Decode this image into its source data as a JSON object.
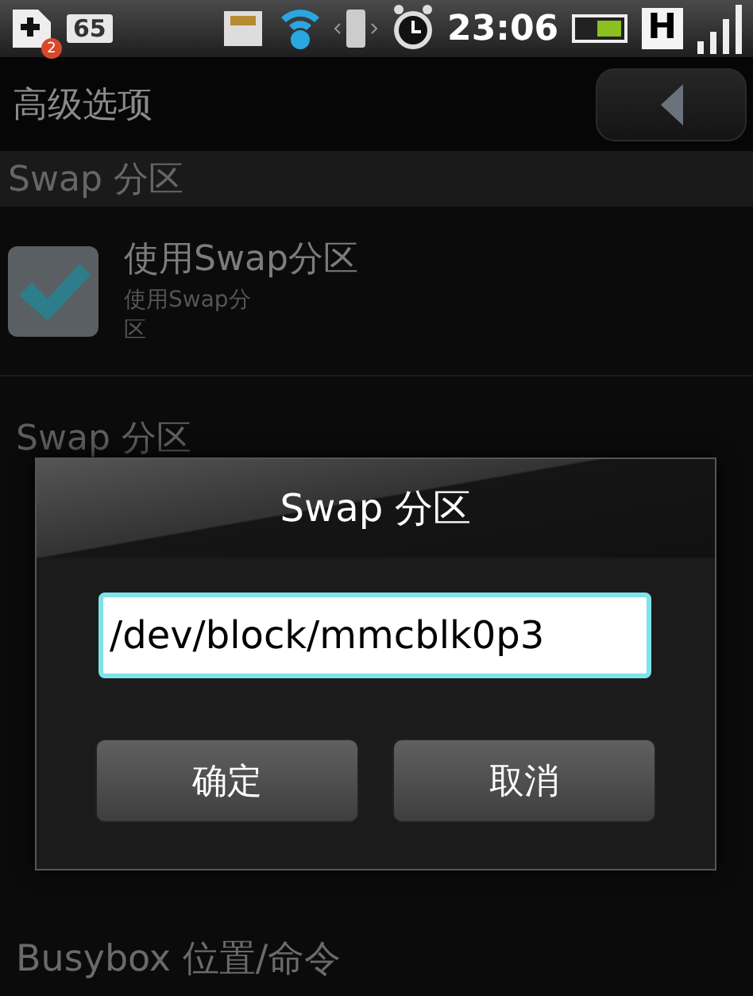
{
  "status_bar": {
    "notification_badge": "2",
    "battery_percent": "65",
    "time": "23:06",
    "network_type": "H"
  },
  "title_bar": {
    "title": "高级选项"
  },
  "sections": [
    {
      "header": "Swap 分区",
      "items": [
        {
          "kind": "checkbox",
          "title": "使用Swap分区",
          "summary": "使用Swap分区",
          "checked": true
        },
        {
          "kind": "plain",
          "title": "Swap 分区"
        }
      ]
    }
  ],
  "bottom_item": {
    "title": "Busybox 位置/命令"
  },
  "dialog": {
    "title": "Swap 分区",
    "value": "/dev/block/mmcblk0p3",
    "buttons": [
      "确定",
      "取消"
    ]
  }
}
